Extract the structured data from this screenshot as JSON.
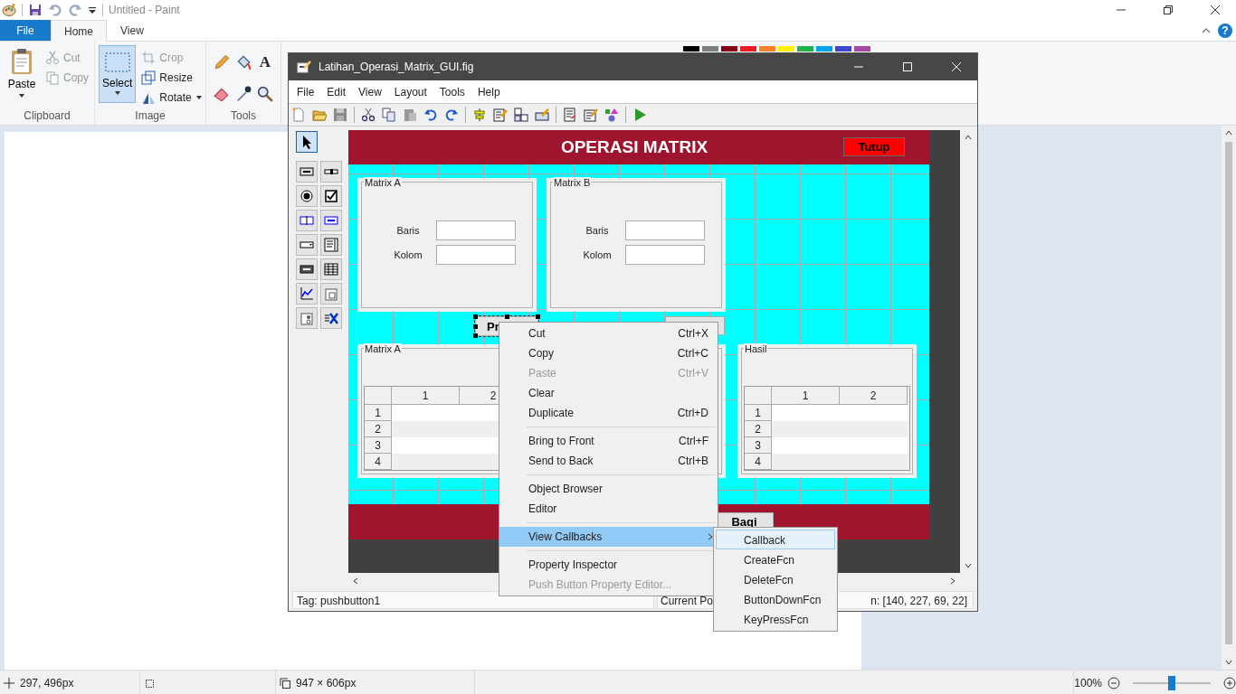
{
  "paint": {
    "title": "Untitled - Paint",
    "help": "?",
    "tabs": [
      {
        "label": "File",
        "selected": false,
        "kind": "file"
      },
      {
        "label": "Home",
        "selected": true,
        "kind": "tab"
      },
      {
        "label": "View",
        "selected": false,
        "kind": "tab"
      }
    ],
    "clipboard": {
      "label": "Clipboard",
      "paste": "Paste",
      "cut": {
        "label": "Cut",
        "disabled": true
      },
      "copy": {
        "label": "Copy",
        "disabled": true
      }
    },
    "image": {
      "label": "Image",
      "select": {
        "label": "Select",
        "selected": true
      },
      "crop": {
        "label": "Crop",
        "disabled": true
      },
      "resize": "Resize",
      "rotate": "Rotate"
    },
    "tools": {
      "label": "Tools",
      "text_tool": "A"
    },
    "palette": [
      {
        "color": "#000000"
      },
      {
        "color": "#7f7f7f"
      },
      {
        "color": "#880015"
      },
      {
        "color": "#ed1c24"
      },
      {
        "color": "#ff7f27"
      },
      {
        "color": "#fff200"
      },
      {
        "color": "#22b14c"
      },
      {
        "color": "#00a2e8"
      },
      {
        "color": "#3f48cc"
      },
      {
        "color": "#a349a4"
      }
    ],
    "status": {
      "cursor": "297, 496px",
      "size": "947 × 606px",
      "zoom": "100%",
      "zoom_slider": {
        "level": 0.5
      }
    }
  },
  "guide": {
    "title": "Latihan_Operasi_Matrix_GUI.fig",
    "menu": [
      "File",
      "Edit",
      "View",
      "Layout",
      "Tools",
      "Help"
    ],
    "pointer_tool": {
      "selected": true
    },
    "tools": [
      {
        "kind": "pushbutton"
      },
      {
        "kind": "slider"
      },
      {
        "kind": "radio"
      },
      {
        "kind": "checkbox"
      },
      {
        "kind": "edit"
      },
      {
        "kind": "text"
      },
      {
        "kind": "popup"
      },
      {
        "kind": "listbox"
      },
      {
        "kind": "toggle"
      },
      {
        "kind": "table"
      },
      {
        "kind": "axes"
      },
      {
        "kind": "panel"
      },
      {
        "kind": "group"
      },
      {
        "kind": "activex"
      }
    ],
    "figure": {
      "title": "OPERASI MATRIX",
      "close_button": "Tutup",
      "input_panels": [
        {
          "title": "Matrix A",
          "rows": [
            {
              "label": "Baris"
            },
            {
              "label": "Kolom"
            }
          ]
        },
        {
          "title": "Matrix B",
          "rows": [
            {
              "label": "Baris"
            },
            {
              "label": "Kolom"
            }
          ]
        }
      ],
      "run_button": {
        "label": "Pr",
        "selected": true
      },
      "table_panels": [
        {
          "title": "Matrix A",
          "columns": [
            "1",
            "2"
          ],
          "rows": [
            "1",
            "2",
            "3",
            "4"
          ]
        },
        {
          "title": "Hasil",
          "columns": [
            "1",
            "2"
          ],
          "rows": [
            "1",
            "2",
            "3",
            "4"
          ]
        }
      ],
      "bottom_button": "Bagi"
    },
    "context_menu": {
      "items": [
        {
          "kind": "item",
          "label": "Cut",
          "shortcut": "Ctrl+X",
          "disabled": false,
          "selected": false
        },
        {
          "kind": "item",
          "label": "Copy",
          "shortcut": "Ctrl+C",
          "disabled": false,
          "selected": false
        },
        {
          "kind": "item",
          "label": "Paste",
          "shortcut": "Ctrl+V",
          "disabled": true,
          "selected": false
        },
        {
          "kind": "item",
          "label": "Clear",
          "disabled": false,
          "selected": false
        },
        {
          "kind": "item",
          "label": "Duplicate",
          "shortcut": "Ctrl+D",
          "disabled": false,
          "selected": false
        },
        {
          "kind": "separator"
        },
        {
          "kind": "item",
          "label": "Bring to Front",
          "shortcut": "Ctrl+F",
          "disabled": false,
          "selected": false
        },
        {
          "kind": "item",
          "label": "Send to Back",
          "shortcut": "Ctrl+B",
          "disabled": false,
          "selected": false
        },
        {
          "kind": "separator"
        },
        {
          "kind": "item",
          "label": "Object Browser",
          "disabled": false,
          "selected": false
        },
        {
          "kind": "item",
          "label": "Editor",
          "disabled": false,
          "selected": false
        },
        {
          "kind": "separator"
        },
        {
          "kind": "submenu",
          "label": "View Callbacks",
          "disabled": false,
          "selected": true
        },
        {
          "kind": "separator"
        },
        {
          "kind": "item",
          "label": "Property Inspector",
          "disabled": false,
          "selected": false
        },
        {
          "kind": "item",
          "label": "Push Button Property Editor...",
          "disabled": true,
          "selected": false
        }
      ],
      "submenu": [
        {
          "label": "Callback",
          "selected": true
        },
        {
          "label": "CreateFcn",
          "selected": false
        },
        {
          "label": "DeleteFcn",
          "selected": false
        },
        {
          "label": "ButtonDownFcn",
          "selected": false
        },
        {
          "label": "KeyPressFcn",
          "selected": false
        }
      ]
    },
    "status": {
      "tag": "Tag: pushbutton1",
      "position_label": "Current Po",
      "position": "n: [140, 227, 69, 22]"
    }
  }
}
